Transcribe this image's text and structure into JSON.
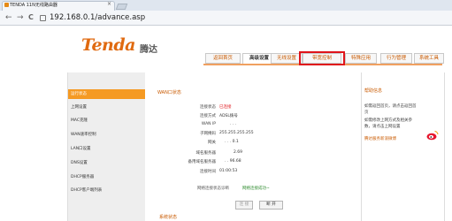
{
  "browser": {
    "tab_title": "TENDA 11N无线路由器",
    "tab_close": "×",
    "url": "192.168.0.1/advance.asp",
    "back": "←",
    "forward": "→",
    "reload": "C"
  },
  "brand": {
    "logo": "Tenda",
    "name_cn": "腾达"
  },
  "main_tabs": [
    "返回首页",
    "高级设置",
    "无线设置",
    "带宽控制",
    "特殊应用",
    "行为管理",
    "系统工具"
  ],
  "sidebar": [
    "运行状态",
    "上网设置",
    "MAC克隆",
    "WAN速率控制",
    "LAN口设置",
    "DNS设置",
    "DHCP服务器",
    "DHCP客户端列表"
  ],
  "wan": {
    "title": "WAN口状态",
    "rows": [
      {
        "label": "连接状态",
        "value": "已连接"
      },
      {
        "label": "连接方式",
        "value": "ADSL拨号"
      },
      {
        "label": "WAN IP",
        "value": ". . ."
      },
      {
        "label": "子网掩码",
        "value": "255.255.255.255"
      },
      {
        "label": "网关",
        "value": ". . . 0.1"
      },
      {
        "label": "域名服务器",
        "value": "2.69"
      },
      {
        "label": "备用域名服务器",
        "value": ". . 96.68"
      },
      {
        "label": "连接时间",
        "value": "01:00:53"
      }
    ],
    "diag_label": "网络连接状态诊断",
    "diag_value": "网络连接成功~",
    "btn_connect": "连 接",
    "btn_disconnect": "断 开"
  },
  "system_title": "系统状态",
  "help": {
    "title": "帮助信息",
    "lines": [
      "如需返回首页，请点击返回首",
      "页",
      "如需修改上网方式及相关参",
      "数，请点击上网设置",
      "腾达服务新浪微博"
    ]
  },
  "colors": {
    "accent": "#f59a23",
    "brand": "#e06a10",
    "highlight": "#e0141a"
  }
}
